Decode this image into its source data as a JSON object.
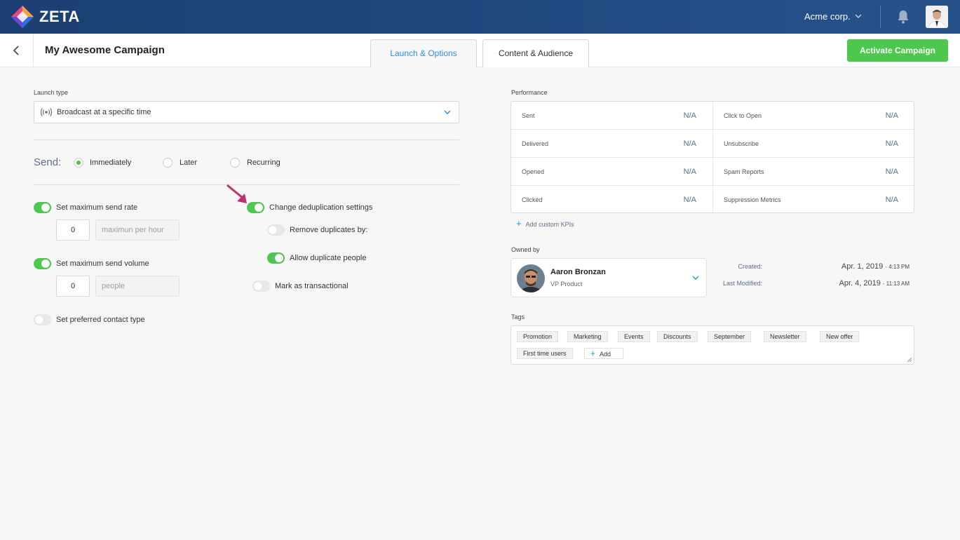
{
  "app": {
    "brand": "ZETA",
    "org": "Acme corp."
  },
  "header": {
    "title": "My Awesome Campaign",
    "tabs": [
      {
        "label": "Launch & Options",
        "active": true
      },
      {
        "label": "Content & Audience",
        "active": false
      }
    ],
    "activate_label": "Activate Campaign"
  },
  "launch": {
    "label": "Launch type",
    "value": "Broadcast at a specific time"
  },
  "send": {
    "label": "Send:",
    "options": [
      {
        "label": "Immediately",
        "selected": true
      },
      {
        "label": "Later",
        "selected": false
      },
      {
        "label": "Recurring",
        "selected": false
      }
    ]
  },
  "options": {
    "max_send_rate": {
      "label": "Set maximum send rate",
      "on": true,
      "value": "0",
      "unit": "maximun per hour"
    },
    "max_send_volume": {
      "label": "Set maximum send volume",
      "on": true,
      "value": "0",
      "unit": "people"
    },
    "preferred_contact": {
      "label": "Set preferred contact type",
      "on": false
    },
    "dedup": {
      "label": "Change deduplication settings",
      "on": true
    },
    "remove_dupes": {
      "label": "Remove duplicates by:",
      "on": false
    },
    "allow_dupes": {
      "label": "Allow duplicate people",
      "on": true
    },
    "transactional": {
      "label": "Mark as transactional",
      "on": false
    }
  },
  "performance": {
    "label": "Performance",
    "left": [
      {
        "label": "Sent",
        "value": "N/A"
      },
      {
        "label": "Delivered",
        "value": "N/A"
      },
      {
        "label": "Opened",
        "value": "N/A"
      },
      {
        "label": "Clicked",
        "value": "N/A"
      }
    ],
    "right": [
      {
        "label": "Click to Open",
        "value": "N/A"
      },
      {
        "label": "Unsubscribe",
        "value": "N/A"
      },
      {
        "label": "Spam Reports",
        "value": "N/A"
      },
      {
        "label": "Suppression Metrics",
        "value": "N/A"
      }
    ],
    "add_kpi": "Add custom KPIs"
  },
  "owner": {
    "label": "Owned by",
    "name": "Aaron Bronzan",
    "role": "VP Product",
    "created_label": "Created:",
    "created_date": "Apr.  1, 2019",
    "created_time": "- 4:13 PM",
    "modified_label": "Last Modified:",
    "modified_date": "Apr.  4, 2019",
    "modified_time": "- 11:13 AM"
  },
  "tags": {
    "label": "Tags",
    "items": [
      "Promotion",
      "Marketing",
      "Events",
      "Discounts",
      "September",
      "Newsletter",
      "New offer",
      "First time users"
    ],
    "add_label": "Add"
  },
  "colors": {
    "accent_green": "#4cc94c",
    "accent_blue": "#2f8ee0",
    "topbar": "#1f467d",
    "arrow": "#c0306e"
  },
  "icons": [
    "zeta-logo-icon",
    "chevron-down-icon",
    "bell-icon",
    "user-avatar-icon",
    "back-arrow-icon",
    "broadcast-icon",
    "plus-icon",
    "pointer-arrow-icon",
    "resize-handle-icon"
  ]
}
